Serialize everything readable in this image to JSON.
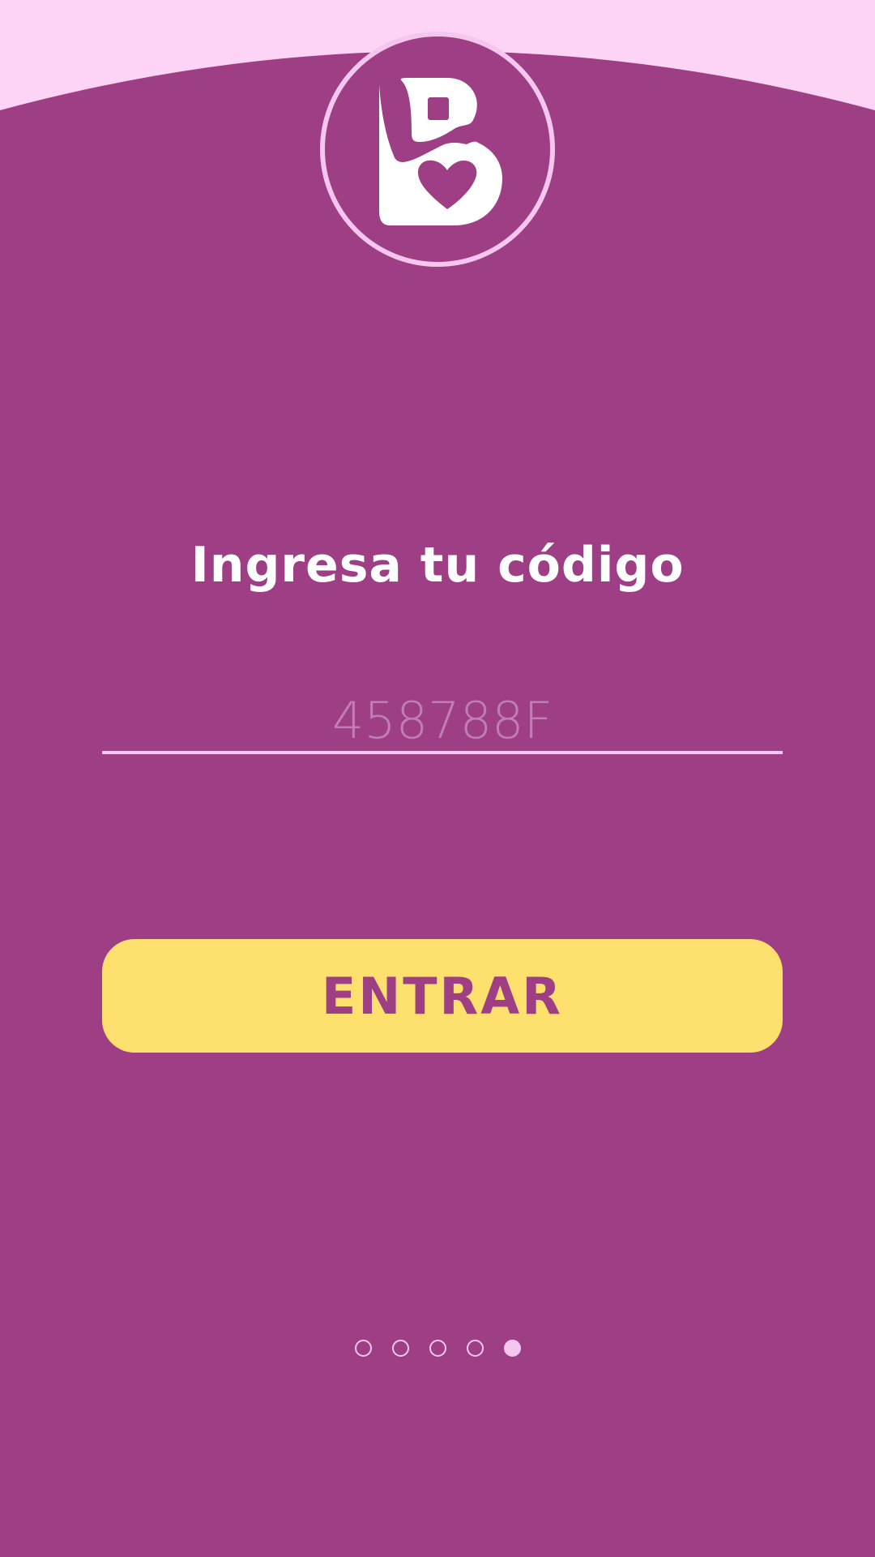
{
  "app": {
    "logo_icon": "b-heart-logo-icon"
  },
  "colors": {
    "background": "#9e3e84",
    "top_band": "#fdd3f6",
    "accent_pink": "#f6c7ee",
    "button": "#fee06e",
    "button_text": "#9e3e84"
  },
  "main": {
    "title": "Ingresa tu código",
    "code_input": {
      "value": "",
      "placeholder": "458788F"
    },
    "enter_button_label": "ENTRAR"
  },
  "pager": {
    "total": 5,
    "active_index": 4
  }
}
